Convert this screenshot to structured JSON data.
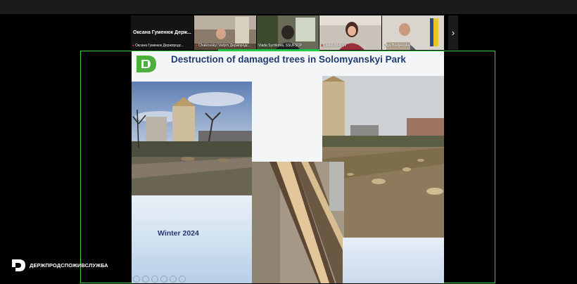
{
  "participants": [
    {
      "name": "Оксана Гуменюк Держпродс...",
      "display": "Оксана Гуменюк Держ...",
      "muted": true
    },
    {
      "name": "Chaikovskyi Vadym Держпродс...",
      "muted": true
    },
    {
      "name": "Vlada Sychkova, SSUFSCP",
      "muted": false
    },
    {
      "name": "Liubov Melnyk",
      "muted": true
    },
    {
      "name": "Olga Baslyevska",
      "muted": false
    }
  ],
  "icons": {
    "mic_muted": "🎤",
    "next": "›"
  },
  "slide": {
    "title": "Destruction of damaged trees in Solomyanskyi Park",
    "caption": "Winter 2024"
  },
  "branding": {
    "name": "ДЕРЖПРОДСПОЖИВСЛУЖБА"
  },
  "colors": {
    "active_speaker": "#14c44a",
    "share_border": "#3ad13a",
    "title": "#1f3c6f",
    "logo_green": "#4cae3b"
  }
}
